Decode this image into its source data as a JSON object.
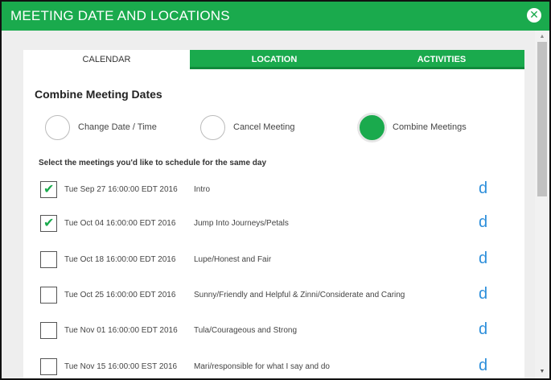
{
  "dialog": {
    "title": "MEETING DATE AND LOCATIONS",
    "close_icon": "close-circle-icon"
  },
  "tabs": [
    {
      "label": "CALENDAR",
      "active": true
    },
    {
      "label": "LOCATION",
      "active": false
    },
    {
      "label": "ACTIVITIES",
      "active": false
    }
  ],
  "section": {
    "heading": "Combine Meeting Dates"
  },
  "options": [
    {
      "label": "Change Date / Time",
      "selected": false
    },
    {
      "label": "Cancel Meeting",
      "selected": false
    },
    {
      "label": "Combine Meetings",
      "selected": true
    }
  ],
  "instructions": "Select the meetings you'd like to schedule for the same day",
  "meetings": [
    {
      "date": "Tue Sep 27 16:00:00 EDT 2016",
      "name": "Intro",
      "checked": true,
      "action": "d"
    },
    {
      "date": "Tue Oct 04 16:00:00 EDT 2016",
      "name": "Jump Into Journeys/Petals",
      "checked": true,
      "action": "d"
    },
    {
      "date": "Tue Oct 18 16:00:00 EDT 2016",
      "name": "Lupe/Honest and Fair",
      "checked": false,
      "action": "d"
    },
    {
      "date": "Tue Oct 25 16:00:00 EDT 2016",
      "name": "Sunny/Friendly and Helpful & Zinni/Considerate and Caring",
      "checked": false,
      "action": "d"
    },
    {
      "date": "Tue Nov 01 16:00:00 EDT 2016",
      "name": "Tula/Courageous and Strong",
      "checked": false,
      "action": "d"
    },
    {
      "date": "Tue Nov 15 16:00:00 EST 2016",
      "name": "Mari/responsible for what I say and do",
      "checked": false,
      "action": "d"
    }
  ],
  "colors": {
    "brand_green": "#1aaa4d",
    "link_blue": "#2d8fdb"
  }
}
